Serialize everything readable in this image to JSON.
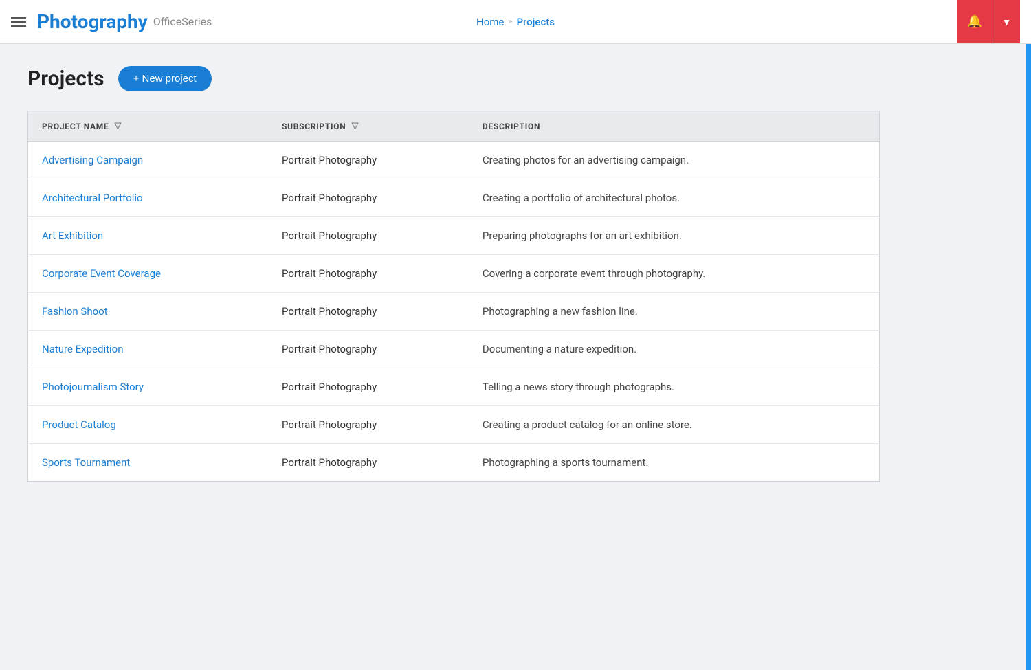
{
  "header": {
    "menu_label": "Menu",
    "title": "Photography",
    "subtitle": "OfficeSeries",
    "breadcrumb": {
      "home": "Home",
      "separator": "»",
      "current": "Projects"
    },
    "bell_icon": "🔔",
    "dropdown_icon": "▼"
  },
  "page": {
    "title": "Projects",
    "new_project_label": "+ New project"
  },
  "table": {
    "columns": [
      {
        "id": "name",
        "label": "PROJECT NAME",
        "has_filter": true
      },
      {
        "id": "subscription",
        "label": "SUBSCRIPTION",
        "has_filter": true
      },
      {
        "id": "description",
        "label": "DESCRIPTION",
        "has_filter": false
      }
    ],
    "rows": [
      {
        "name": "Advertising Campaign",
        "subscription": "Portrait Photography",
        "description": "Creating photos for an advertising campaign."
      },
      {
        "name": "Architectural Portfolio",
        "subscription": "Portrait Photography",
        "description": "Creating a portfolio of architectural photos."
      },
      {
        "name": "Art Exhibition",
        "subscription": "Portrait Photography",
        "description": "Preparing photographs for an art exhibition."
      },
      {
        "name": "Corporate Event Coverage",
        "subscription": "Portrait Photography",
        "description": "Covering a corporate event through photography."
      },
      {
        "name": "Fashion Shoot",
        "subscription": "Portrait Photography",
        "description": "Photographing a new fashion line."
      },
      {
        "name": "Nature Expedition",
        "subscription": "Portrait Photography",
        "description": "Documenting a nature expedition."
      },
      {
        "name": "Photojournalism Story",
        "subscription": "Portrait Photography",
        "description": "Telling a news story through photographs."
      },
      {
        "name": "Product Catalog",
        "subscription": "Portrait Photography",
        "description": "Creating a product catalog for an online store."
      },
      {
        "name": "Sports Tournament",
        "subscription": "Portrait Photography",
        "description": "Photographing a sports tournament."
      }
    ]
  }
}
